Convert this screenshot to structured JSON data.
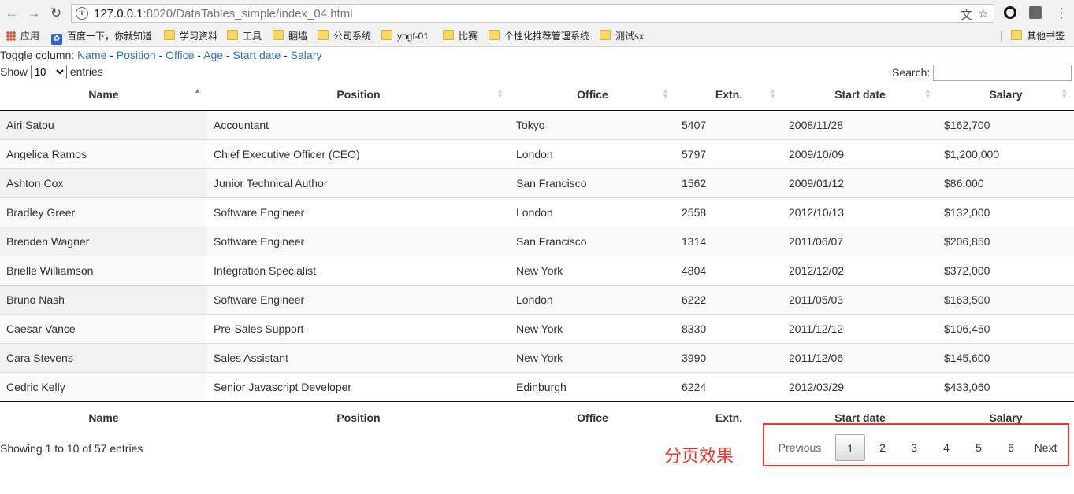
{
  "browser": {
    "url_host": "127.0.0.1",
    "url_path": ":8020/DataTables_simple/index_04.html"
  },
  "bookmarks": [
    {
      "label": "应用",
      "icon": "apps-icon"
    },
    {
      "label": "百度一下，你就知道",
      "icon": "baidu-paw-icon"
    },
    {
      "label": "学习资料",
      "icon": "folder-icon"
    },
    {
      "label": "工具",
      "icon": "folder-icon"
    },
    {
      "label": "翻墙",
      "icon": "folder-icon"
    },
    {
      "label": "公司系统",
      "icon": "folder-icon"
    },
    {
      "label": "yhgf-01",
      "icon": "folder-icon"
    },
    {
      "label": "比赛",
      "icon": "folder-icon"
    },
    {
      "label": "个性化推荐管理系统",
      "icon": "folder-icon"
    },
    {
      "label": "测试sx",
      "icon": "folder-icon"
    },
    {
      "label": "其他书签",
      "icon": "folder-icon"
    }
  ],
  "toggle": {
    "prefix": "Toggle column:",
    "links": [
      "Name",
      "Position",
      "Office",
      "Age",
      "Start date",
      "Salary"
    ],
    "sep": "-"
  },
  "length": {
    "show": "Show",
    "value": "10",
    "entries": "entries"
  },
  "search": {
    "label": "Search:"
  },
  "table": {
    "columns": [
      "Name",
      "Position",
      "Office",
      "Extn.",
      "Start date",
      "Salary"
    ],
    "rows": [
      [
        "Airi Satou",
        "Accountant",
        "Tokyo",
        "5407",
        "2008/11/28",
        "$162,700"
      ],
      [
        "Angelica Ramos",
        "Chief Executive Officer (CEO)",
        "London",
        "5797",
        "2009/10/09",
        "$1,200,000"
      ],
      [
        "Ashton Cox",
        "Junior Technical Author",
        "San Francisco",
        "1562",
        "2009/01/12",
        "$86,000"
      ],
      [
        "Bradley Greer",
        "Software Engineer",
        "London",
        "2558",
        "2012/10/13",
        "$132,000"
      ],
      [
        "Brenden Wagner",
        "Software Engineer",
        "San Francisco",
        "1314",
        "2011/06/07",
        "$206,850"
      ],
      [
        "Brielle Williamson",
        "Integration Specialist",
        "New York",
        "4804",
        "2012/12/02",
        "$372,000"
      ],
      [
        "Bruno Nash",
        "Software Engineer",
        "London",
        "6222",
        "2011/05/03",
        "$163,500"
      ],
      [
        "Caesar Vance",
        "Pre-Sales Support",
        "New York",
        "8330",
        "2011/12/12",
        "$106,450"
      ],
      [
        "Cara Stevens",
        "Sales Assistant",
        "New York",
        "3990",
        "2011/12/06",
        "$145,600"
      ],
      [
        "Cedric Kelly",
        "Senior Javascript Developer",
        "Edinburgh",
        "6224",
        "2012/03/29",
        "$433,060"
      ]
    ]
  },
  "info": "Showing 1 to 10 of 57 entries",
  "annotation": "分页效果",
  "pager": {
    "previous": "Previous",
    "pages": [
      "1",
      "2",
      "3",
      "4",
      "5",
      "6"
    ],
    "current": "1",
    "next": "Next"
  },
  "colors": {
    "link": "#3276b1",
    "annotation": "#e33333"
  }
}
